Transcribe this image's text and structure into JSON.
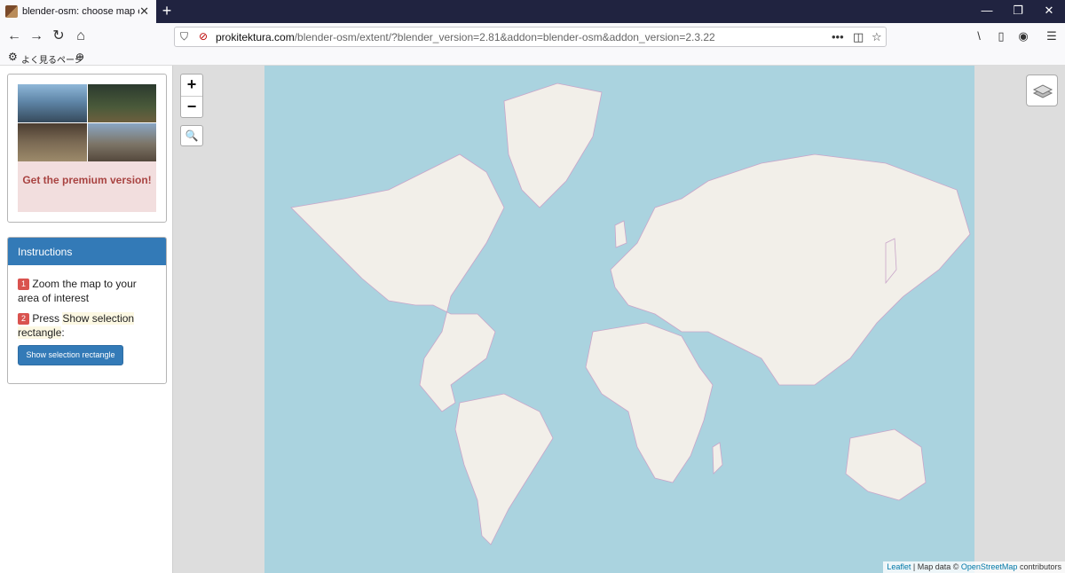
{
  "browser": {
    "tab_title": "blender-osm: choose map extent",
    "tab_close": "✕",
    "new_tab": "+",
    "window_controls": {
      "minimize": "—",
      "restore": "❐",
      "close": "✕"
    },
    "nav": {
      "back": "←",
      "forward": "→",
      "reload": "↻",
      "home": "⌂"
    },
    "url": {
      "domain": "prokitektura.com",
      "path": "/blender-osm/extent/?blender_version=2.81&addon=blender-osm&addon_version=2.3.22"
    },
    "url_actions": {
      "more": "•••",
      "pocket": "◫",
      "bookmark": "☆"
    },
    "toolbar": {
      "library": "\\",
      "sidebar": "▯",
      "account": "◉",
      "menu": "☰"
    },
    "bookmarks": {
      "settings_icon": "⚙",
      "label": "よく見るページ",
      "globe_icon": "⊕"
    }
  },
  "sidebar": {
    "promo": {
      "label": "Get the premium version!"
    },
    "instructions": {
      "title": "Instructions",
      "step1_num": "1",
      "step1_text": "Zoom the map to your area of interest",
      "step2_num": "2",
      "step2_prefix": "Press",
      "step2_highlight": "Show selection rectangle",
      "step2_suffix": ":",
      "button_label": "Show selection rectangle"
    }
  },
  "map": {
    "zoom_in": "+",
    "zoom_out": "−",
    "search_icon": "🔍",
    "attribution": {
      "leaflet": "Leaflet",
      "separator": "| Map data ©",
      "osm": "OpenStreetMap",
      "contributors": "contributors"
    },
    "colors": {
      "ocean": "#aad3df",
      "land": "#f2efe9",
      "border": "#c9a5c9",
      "outside": "#dddddd"
    }
  }
}
